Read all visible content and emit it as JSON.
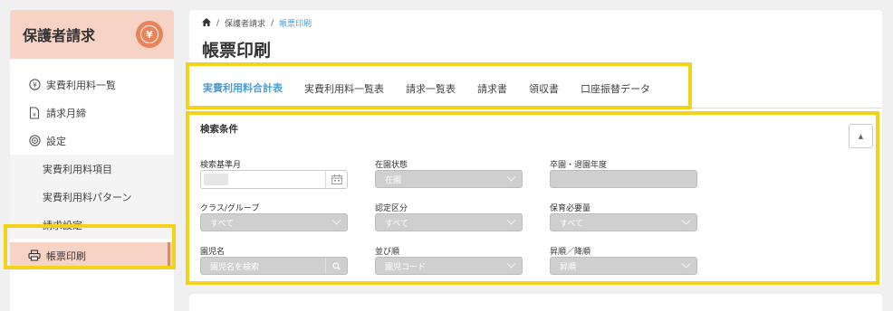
{
  "sidebar": {
    "title": "保護者請求",
    "items": [
      {
        "label": "実費利用料一覧",
        "icon": "yen-circle-icon"
      },
      {
        "label": "請求月締",
        "icon": "document-icon"
      },
      {
        "label": "設定",
        "icon": "target-icon"
      }
    ],
    "subitems": [
      "実費利用料項目",
      "実費利用料パターン",
      "請求設定"
    ],
    "active": {
      "label": "帳票印刷",
      "icon": "printer-icon"
    }
  },
  "breadcrumb": {
    "home_icon": "home-icon",
    "parent": "保護者請求",
    "current": "帳票印刷",
    "sep": "/"
  },
  "page_title": "帳票印刷",
  "tabs": [
    "実費利用料合計表",
    "実費利用料一覧表",
    "請求一覧表",
    "請求書",
    "領収書",
    "口座振替データ"
  ],
  "search": {
    "title": "検索条件",
    "fields": {
      "base_month": {
        "label": "検索基準月"
      },
      "enroll_status": {
        "label": "在園状態",
        "value": "在園"
      },
      "grad_year": {
        "label": "卒園・退園年度",
        "value": ""
      },
      "class_group": {
        "label": "クラス/グループ",
        "value": "すべて"
      },
      "cert_class": {
        "label": "認定区分",
        "value": "すべて"
      },
      "care_need": {
        "label": "保育必要量",
        "value": "すべて"
      },
      "child_name": {
        "label": "園児名",
        "placeholder": "園児名を検索"
      },
      "sort_order": {
        "label": "並び順",
        "value": "園児コード"
      },
      "asc_desc": {
        "label": "昇順／降順",
        "value": "昇順"
      }
    }
  },
  "colors": {
    "accent": "#4a9ed8",
    "brand": "#e9835a",
    "highlight": "#f3d21a",
    "sidebar_header": "#f7d3c6"
  }
}
